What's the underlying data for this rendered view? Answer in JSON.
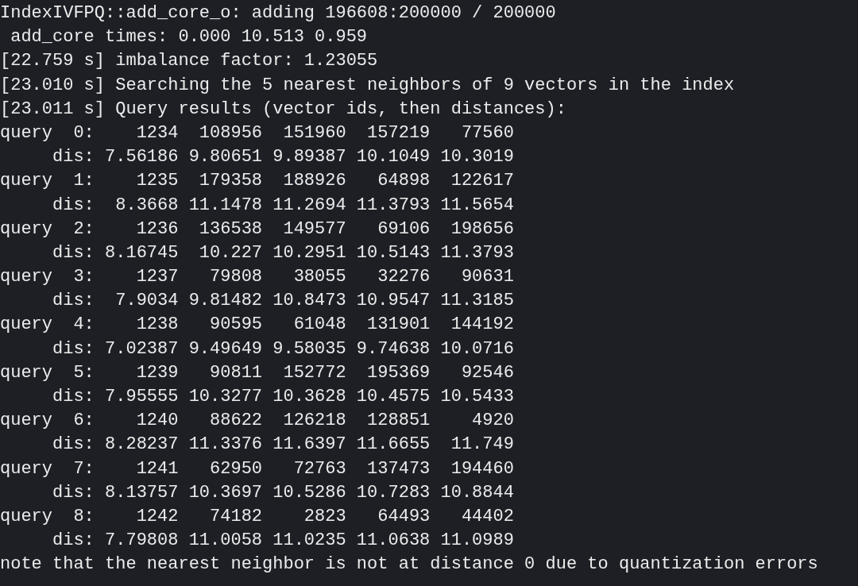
{
  "terminal": {
    "lines": [
      "IndexIVFPQ::add_core_o: adding 196608:200000 / 200000",
      " add_core times: 0.000 10.513 0.959",
      "[22.759 s] imbalance factor: 1.23055",
      "[23.010 s] Searching the 5 nearest neighbors of 9 vectors in the index",
      "[23.011 s] Query results (vector ids, then distances):",
      "query  0:    1234  108956  151960  157219   77560",
      "     dis: 7.56186 9.80651 9.89387 10.1049 10.3019",
      "query  1:    1235  179358  188926   64898  122617",
      "     dis:  8.3668 11.1478 11.2694 11.3793 11.5654",
      "query  2:    1236  136538  149577   69106  198656",
      "     dis: 8.16745  10.227 10.2951 10.5143 11.3793",
      "query  3:    1237   79808   38055   32276   90631",
      "     dis:  7.9034 9.81482 10.8473 10.9547 11.3185",
      "query  4:    1238   90595   61048  131901  144192",
      "     dis: 7.02387 9.49649 9.58035 9.74638 10.0716",
      "query  5:    1239   90811  152772  195369   92546",
      "     dis: 7.95555 10.3277 10.3628 10.4575 10.5433",
      "query  6:    1240   88622  126218  128851    4920",
      "     dis: 8.28237 11.3376 11.6397 11.6655  11.749",
      "query  7:    1241   62950   72763  137473  194460",
      "     dis: 8.13757 10.3697 10.5286 10.7283 10.8844",
      "query  8:    1242   74182    2823   64493   44402",
      "     dis: 7.79808 11.0058 11.0235 11.0638 11.0989",
      "note that the nearest neighbor is not at distance 0 due to quantization errors"
    ]
  }
}
